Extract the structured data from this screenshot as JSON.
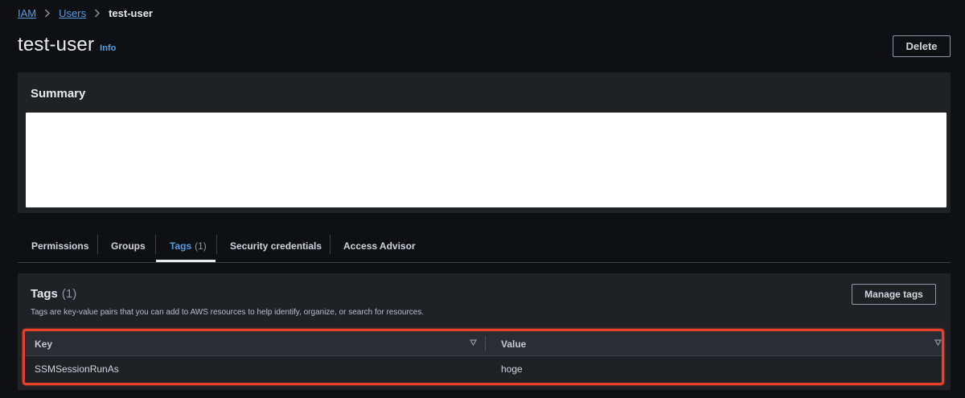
{
  "breadcrumb": {
    "items": [
      "IAM",
      "Users"
    ],
    "current": "test-user"
  },
  "page": {
    "title": "test-user",
    "info_label": "Info",
    "delete_label": "Delete"
  },
  "summary": {
    "title": "Summary"
  },
  "tabs": [
    {
      "label": "Permissions",
      "count": ""
    },
    {
      "label": "Groups",
      "count": ""
    },
    {
      "label": "Tags",
      "count": "(1)"
    },
    {
      "label": "Security credentials",
      "count": ""
    },
    {
      "label": "Access Advisor",
      "count": ""
    }
  ],
  "tags": {
    "title": "Tags",
    "count": "(1)",
    "description": "Tags are key-value pairs that you can add to AWS resources to help identify, organize, or search for resources.",
    "manage_label": "Manage tags",
    "columns": [
      "Key",
      "Value"
    ],
    "rows": [
      {
        "key": "SSMSessionRunAs",
        "value": "hoge"
      }
    ]
  },
  "colors": {
    "link": "#539fe5",
    "highlight": "#e8412a"
  }
}
